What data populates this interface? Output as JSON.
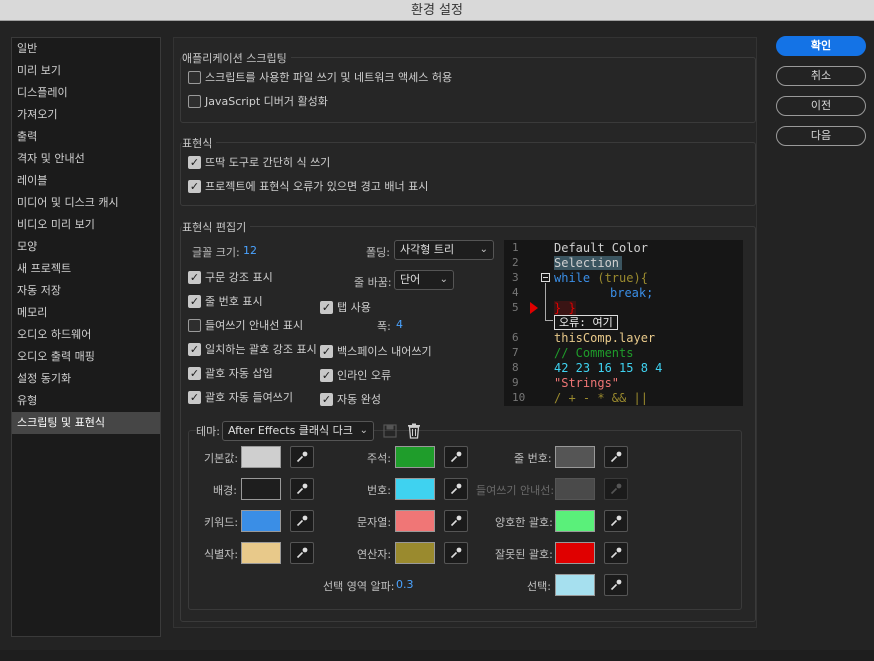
{
  "window": {
    "title": "환경 설정"
  },
  "sidebar": {
    "items": [
      {
        "label": "일반"
      },
      {
        "label": "미리 보기"
      },
      {
        "label": "디스플레이"
      },
      {
        "label": "가져오기"
      },
      {
        "label": "출력"
      },
      {
        "label": "격자 및 안내선"
      },
      {
        "label": "레이블"
      },
      {
        "label": "미디어 및 디스크 캐시"
      },
      {
        "label": "비디오 미리 보기"
      },
      {
        "label": "모양"
      },
      {
        "label": "새 프로젝트"
      },
      {
        "label": "자동 저장"
      },
      {
        "label": "메모리"
      },
      {
        "label": "오디오 하드웨어"
      },
      {
        "label": "오디오 출력 매핑"
      },
      {
        "label": "설정 동기화"
      },
      {
        "label": "유형"
      },
      {
        "label": "스크립팅 및 표현식"
      }
    ],
    "selected": "스크립팅 및 표현식"
  },
  "buttons": {
    "ok": "확인",
    "cancel": "취소",
    "prev": "이전",
    "next": "다음"
  },
  "app_scripting": {
    "title": "애플리케이션 스크립팅",
    "allow_files_network": {
      "label": "스크립트를 사용한 파일 쓰기 및 네트워크 액세스 허용",
      "checked": false
    },
    "js_debugger": {
      "label": "JavaScript 디버거 활성화",
      "checked": false
    }
  },
  "expressions": {
    "title": "표현식",
    "pickwhip_compact": {
      "label": "뜨딱 도구로 간단히 식 쓰기",
      "checked": true
    },
    "warning_banner": {
      "label": "프로젝트에 표현식 오류가 있으면 경고 배너 표시",
      "checked": true
    }
  },
  "editor": {
    "title": "표현식 편집기",
    "font_size_label": "글꼴 크기:",
    "font_size_value": "12",
    "folding_label": "폴딩:",
    "folding_value": "사각형 트리",
    "wrap_label": "줄 바꿈:",
    "wrap_value": "단어",
    "tab_width_label": "폭:",
    "tab_width_value": "4",
    "checkboxes": {
      "syntax_highlight": {
        "label": "구문 강조 표시",
        "checked": true
      },
      "line_numbers": {
        "label": "줄 번호 표시",
        "checked": true
      },
      "use_tabs": {
        "label": "탭 사용",
        "checked": true
      },
      "indent_guides": {
        "label": "들여쓰기 안내선 표시",
        "checked": false
      },
      "matching_brackets": {
        "label": "일치하는 괄호 강조 표시",
        "checked": true
      },
      "backspace_unindent": {
        "label": "백스페이스 내어쓰기",
        "checked": true
      },
      "auto_brackets": {
        "label": "괄호 자동 삽입",
        "checked": true
      },
      "inline_errors": {
        "label": "인라인 오류",
        "checked": true
      },
      "auto_indent_brackets": {
        "label": "괄호 자동 들여쓰기",
        "checked": true
      },
      "autocomplete": {
        "label": "자동 완성",
        "checked": true
      }
    },
    "preview": {
      "line_numbers": [
        "1",
        "2",
        "3",
        "4",
        "5",
        "6",
        "7",
        "8",
        "9",
        "10"
      ],
      "lines": {
        "l1": "Default Color",
        "l2": "Selection",
        "l3_kw": "while",
        "l3_paren": " (",
        "l3_true": "true",
        "l3_end": "){",
        "l4": "break;",
        "l5": "} }",
        "error_tooltip": "오류: 여기",
        "l6": "thisComp.layer",
        "l7": "// Comments",
        "l8": "42 23 16 15 8 4",
        "l9": "\"Strings\"",
        "l10": "/ + - * && ||"
      }
    }
  },
  "theme": {
    "label": "테마:",
    "value": "After Effects 클래식 다크",
    "colors": {
      "default": {
        "label": "기본값:",
        "hex": "#cfcfcf"
      },
      "background": {
        "label": "배경:",
        "hex": "#1e1e1e"
      },
      "keyword": {
        "label": "키워드:",
        "hex": "#3a8ee6"
      },
      "identifier": {
        "label": "식별자:",
        "hex": "#e8c98a"
      },
      "comment": {
        "label": "주석:",
        "hex": "#1f9d2b"
      },
      "number": {
        "label": "번호:",
        "hex": "#3fd2f0"
      },
      "string": {
        "label": "문자열:",
        "hex": "#f07676"
      },
      "operator": {
        "label": "연산자:",
        "hex": "#9a8a2e"
      },
      "line_number": {
        "label": "줄 번호:",
        "hex": "#555555"
      },
      "indent_guide": {
        "label": "들여쓰기 안내선:",
        "hex": "#4a4a4a"
      },
      "good_bracket": {
        "label": "양호한 괄호:",
        "hex": "#5af07a"
      },
      "bad_bracket": {
        "label": "잘못된 괄호:",
        "hex": "#e00000"
      },
      "selection": {
        "label": "선택:",
        "hex": "#a6e0ef"
      }
    },
    "selection_alpha_label": "선택 영역 알파:",
    "selection_alpha_value": "0.3"
  }
}
